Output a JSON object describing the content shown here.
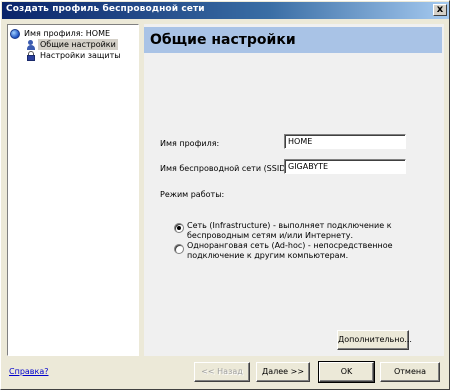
{
  "window": {
    "title": "Создать профиль беспроводной сети",
    "close_glyph": "x"
  },
  "tree": {
    "items": [
      {
        "label": "Имя профиля: HOME",
        "icon": "globe-icon"
      },
      {
        "label": "Общие настройки",
        "icon": "users-icon",
        "selected": true
      },
      {
        "label": "Настройки защиты",
        "icon": "lock-icon"
      }
    ]
  },
  "page": {
    "title": "Общие настройки"
  },
  "form": {
    "profile_name_label": "Имя профиля:",
    "profile_name_value": "HOME",
    "ssid_label": "Имя беспроводной сети (SSID):",
    "ssid_value": "GIGABYTE",
    "mode_label": "Режим работы:",
    "mode_options": [
      {
        "label": "Сеть (Infrastructure) - выполняет подключение к беспроводным сетям и/или Интернету.",
        "checked": true
      },
      {
        "label": "Одноранговая сеть (Ad-hoc) - непосредственное подключение к другим компьютерам.",
        "checked": false
      }
    ],
    "advanced_button": "Дополнительно..."
  },
  "footer": {
    "help_link": "Справка?",
    "back_button": "<< Назад",
    "next_button": "Далее >>",
    "ok_button": "OK",
    "cancel_button": "Отмена"
  }
}
